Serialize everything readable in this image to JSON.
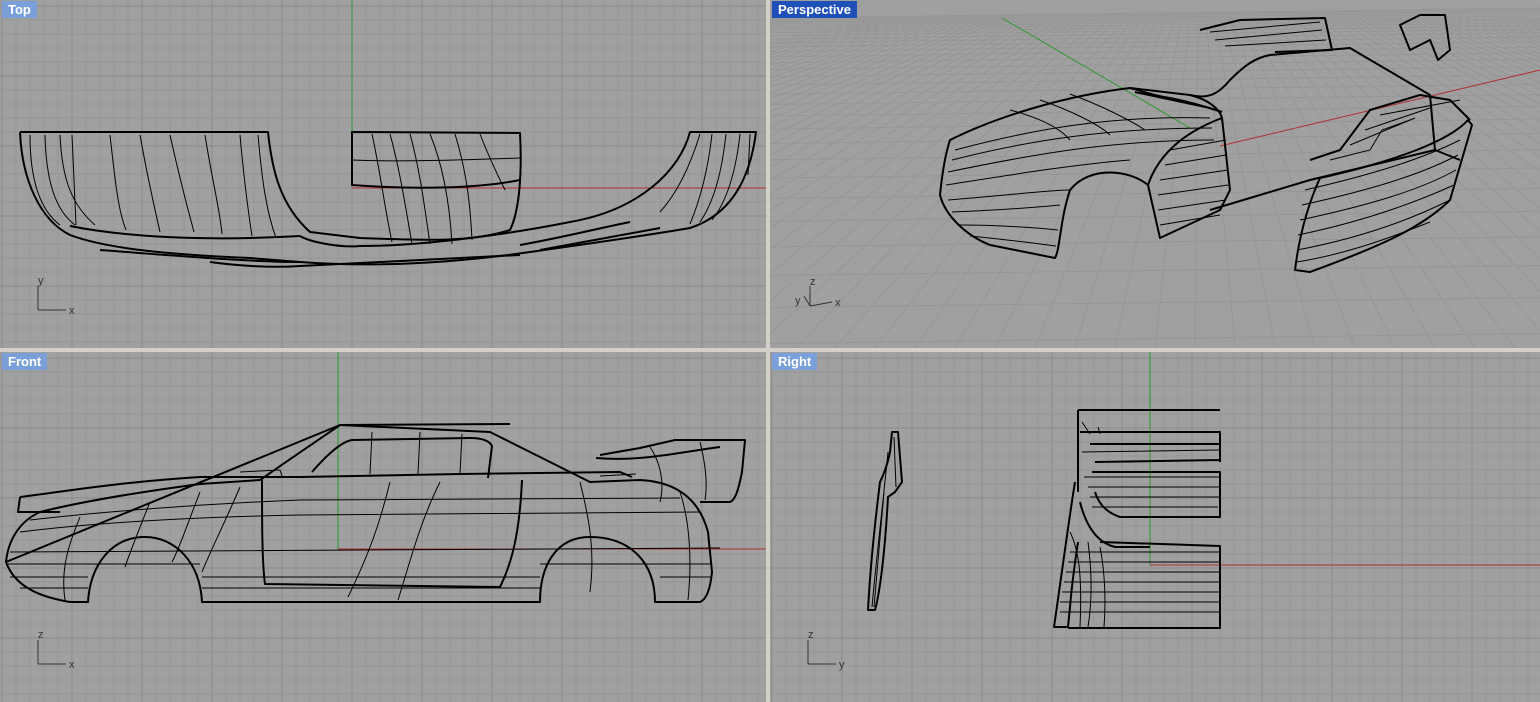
{
  "viewports": {
    "top": {
      "label": "Top",
      "axes": {
        "a": "y",
        "b": "x"
      }
    },
    "perspective": {
      "label": "Perspective",
      "axes": {
        "a": "z",
        "b": "y",
        "c": "x"
      }
    },
    "front": {
      "label": "Front",
      "axes": {
        "a": "z",
        "b": "x"
      }
    },
    "right": {
      "label": "Right",
      "axes": {
        "a": "z",
        "b": "y"
      }
    }
  },
  "colors": {
    "viewport_bg": "#a0a0a0",
    "label_bg": "#7b9fd8",
    "label_active_bg": "#1f50b8",
    "x_axis": "#b03030",
    "y_axis": "#2a9a2a",
    "wire": "#000000"
  },
  "active_viewport": "perspective"
}
